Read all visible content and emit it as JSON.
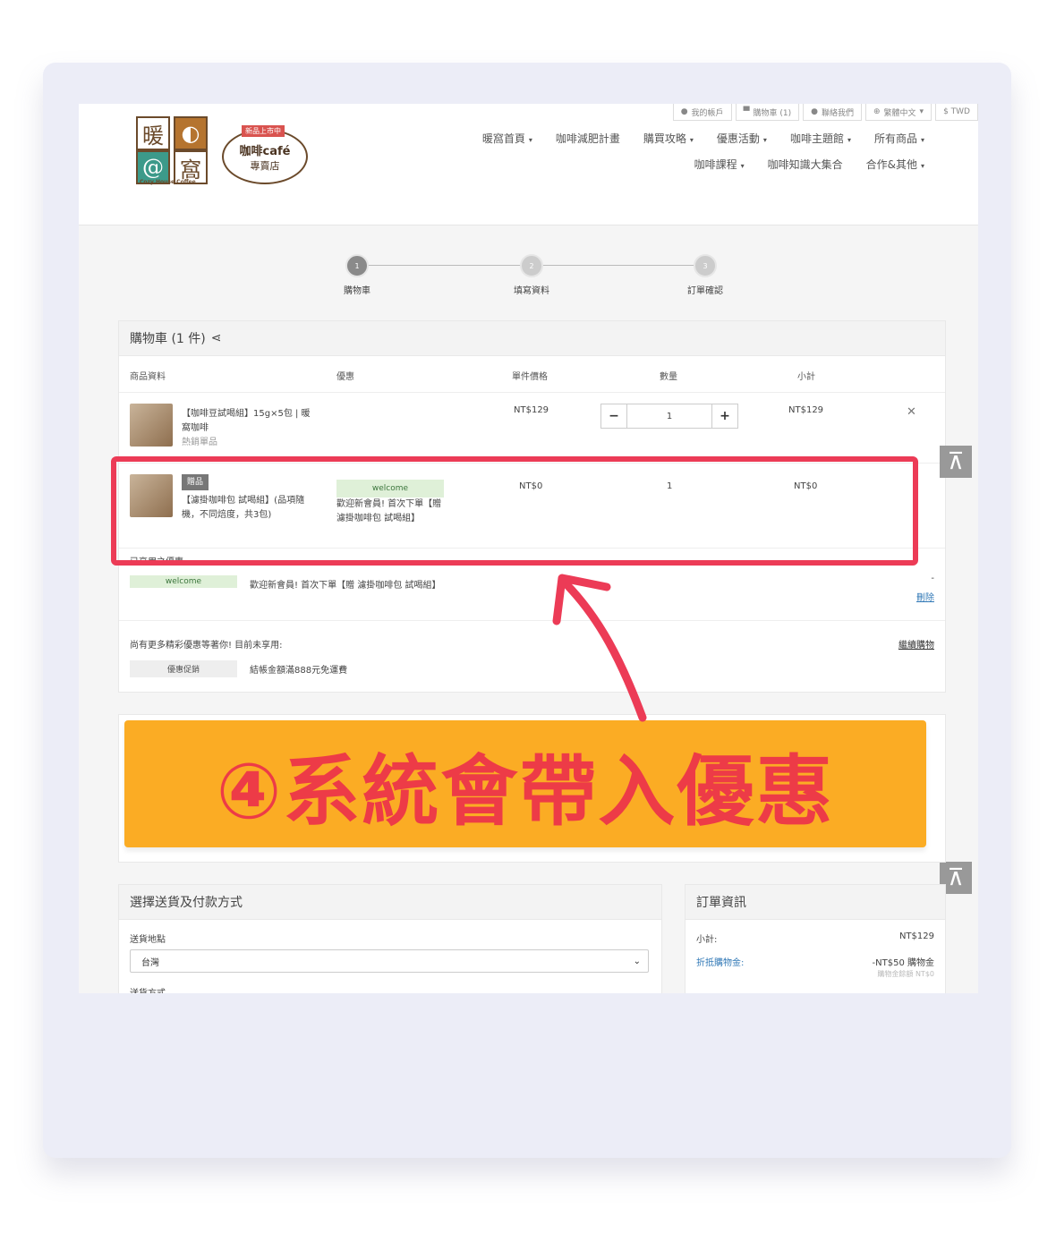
{
  "topbar": {
    "account": "我的帳戶",
    "cart": "購物車 (1)",
    "contact": "聯絡我們",
    "language": "繁體中文",
    "currency": "$ TWD"
  },
  "logo": {
    "char1": "暖",
    "char2": "窩",
    "new_tag": "新品上市中",
    "bubble_line1": "咖啡café",
    "bubble_line2": "專賣店",
    "brand_en": "Cozy House Coffee"
  },
  "nav": {
    "row1": [
      "暖窩首頁",
      "咖啡減肥計畫",
      "購買攻略",
      "優惠活動",
      "咖啡主題館",
      "所有商品"
    ],
    "row2": [
      "咖啡課程",
      "咖啡知識大集合",
      "合作&其他"
    ]
  },
  "steps": [
    {
      "num": "1",
      "label": "購物車"
    },
    {
      "num": "2",
      "label": "填寫資料"
    },
    {
      "num": "3",
      "label": "訂單確認"
    }
  ],
  "cart": {
    "title": "購物車 (1 件)",
    "columns": [
      "商品資料",
      "優惠",
      "單件價格",
      "數量",
      "小計"
    ],
    "item1": {
      "name": "【咖啡豆試喝組】15g×5包 | 暖窩咖啡",
      "tag": "熱銷單品",
      "price": "NT$129",
      "qty": "1",
      "subtotal": "NT$129"
    },
    "item2": {
      "gift_tag": "贈品",
      "name": "【濾掛咖啡包 試喝組】(品項隨機，不同焙度，共3包)",
      "promo_code": "welcome",
      "promo_desc": "歡迎新會員! 首次下單【贈 濾掛咖啡包 試喝組】",
      "price": "NT$0",
      "qty": "1",
      "subtotal": "NT$0"
    },
    "applied_title": "已享用之優惠",
    "applied_code": "welcome",
    "applied_desc": "歡迎新會員! 首次下單【贈 濾掛咖啡包 試喝組】",
    "applied_dash": "-",
    "delete": "刪除",
    "more_title": "尚有更多精彩優惠等著你! 目前未享用:",
    "continue": "繼續購物",
    "more_badge": "優惠促銷",
    "more_desc": "結帳金額滿888元免運費"
  },
  "banner": "④系統會帶入優惠",
  "shipping": {
    "title": "選擇送貨及付款方式",
    "region_label": "送貨地點",
    "region_value": "台灣",
    "method_label": "送貨方式"
  },
  "order": {
    "title": "訂單資訊",
    "subtotal_label": "小計:",
    "subtotal_value": "NT$129",
    "credit_label": "折抵購物金:",
    "credit_value": "-NT$50 購物金",
    "credit_note": "購物金餘額 NT$0"
  },
  "colors": {
    "highlight": "#ec3b56",
    "banner_bg": "#fbac24",
    "banner_text": "#ed3b47"
  }
}
